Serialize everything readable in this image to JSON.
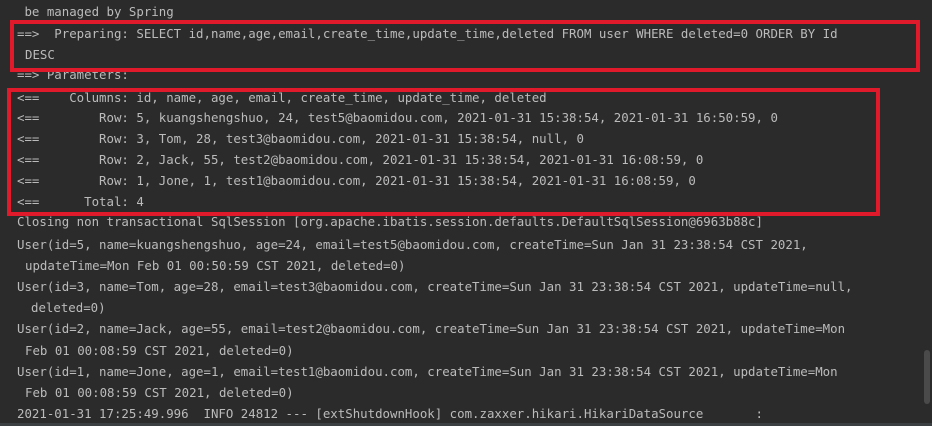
{
  "console": {
    "lines": [
      " be managed by Spring",
      "==>  Preparing: SELECT id,name,age,email,create_time,update_time,deleted FROM user WHERE deleted=0 ORDER BY Id",
      "DESC",
      "==> Parameters: ",
      "<==    Columns: id, name, age, email, create_time, update_time, deleted",
      "<==        Row: 5, kuangshengshuo, 24, test5@baomidou.com, 2021-01-31 15:38:54, 2021-01-31 16:50:59, 0",
      "<==        Row: 3, Tom, 28, test3@baomidou.com, 2021-01-31 15:38:54, null, 0",
      "<==        Row: 2, Jack, 55, test2@baomidou.com, 2021-01-31 15:38:54, 2021-01-31 16:08:59, 0",
      "<==        Row: 1, Jone, 1, test1@baomidou.com, 2021-01-31 15:38:54, 2021-01-31 16:08:59, 0",
      "<==      Total: 4",
      "Closing non transactional SqlSession [org.apache.ibatis.session.defaults.DefaultSqlSession@6963b88c]",
      "User(id=5, name=kuangshengshuo, age=24, email=test5@baomidou.com, createTime=Sun Jan 31 23:38:54 CST 2021,",
      "updateTime=Mon Feb 01 00:50:59 CST 2021, deleted=0)",
      "User(id=3, name=Tom, age=28, email=test3@baomidou.com, createTime=Sun Jan 31 23:38:54 CST 2021, updateTime=null,",
      "deleted=0)",
      "User(id=2, name=Jack, age=55, email=test2@baomidou.com, createTime=Sun Jan 31 23:38:54 CST 2021, updateTime=Mon",
      "Feb 01 00:08:59 CST 2021, deleted=0)",
      "User(id=1, name=Jone, age=1, email=test1@baomidou.com, createTime=Sun Jan 31 23:38:54 CST 2021, updateTime=Mon",
      "Feb 01 00:08:59 CST 2021, deleted=0)",
      "2021-01-31 17:25:49.996  INFO 24812 --- [extShutdownHook] com.zaxxer.hikari.HikariDataSource       :"
    ]
  },
  "colors": {
    "background": "#2b2b2b",
    "text": "#bbbbbb",
    "highlight": "#e0192b"
  }
}
